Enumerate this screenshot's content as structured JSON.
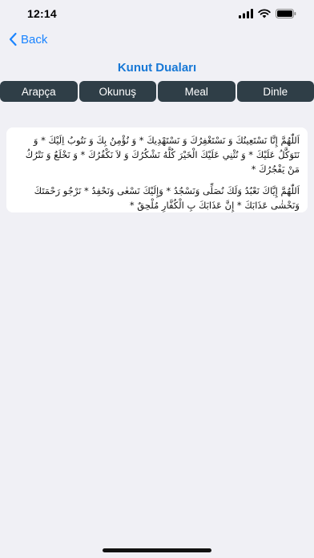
{
  "status_bar": {
    "time": "12:14",
    "icons": [
      "signal-icon",
      "wifi-icon",
      "battery-icon"
    ]
  },
  "nav": {
    "back_label": "Back"
  },
  "page": {
    "title": "Kunut Duaları"
  },
  "tabs": [
    {
      "label": "Arapça"
    },
    {
      "label": "Okunuş"
    },
    {
      "label": "Meal"
    },
    {
      "label": "Dinle"
    }
  ],
  "content": {
    "paragraphs": [
      "اَللّٰهُمَّ إِنَّا نَسْتَعِينُكَ وَ نَسْتَغْفِرُكَ وَ نَسْتَهْدِيكَ * وَ نُؤْمِنُ بِكَ وَ نَتُوبُ اِلَيْكَ * وَ نَتَوَكَّلُ عَلَيْكَ * وَ نُثْنِي عَلَيْكَ الْخَيْرَ كُلَّهُ نَشْكُرُكَ وَ لاَ نَكْفُرُكَ * وَ نَخْلَعُ وَ نَتْرُكُ مَنْ يَفْجُرُكَ *",
      "اَللّٰهُمَّ إِيَّاكَ نَعْبُدُ وَلَكَ نُصَلِّى وَنَسْجُدُ * وَإِلَيْكَ نَسْعٰى وَنَحْفِدُ * نَرْجُو رَحْمَتَكَ وَنَخْشٰى عَذَابَكَ * إِنَّ عَذَابَكَ بِ الْكُفَّارِ مُلْحِقٌ *"
    ]
  },
  "colors": {
    "accent": "#1a84ff",
    "title": "#1778d6",
    "tab_bg": "#2f3e47",
    "background": "#f0f0f5"
  }
}
